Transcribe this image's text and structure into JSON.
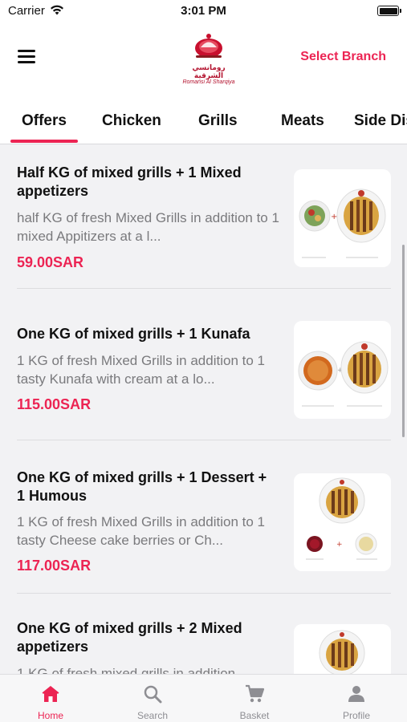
{
  "status_bar": {
    "carrier": "Carrier",
    "time": "3:01 PM"
  },
  "header": {
    "logo_text_ar": "رومانسي الشرقية",
    "logo_text_en": "Romansi Al Sharqiya",
    "select_branch": "Select Branch",
    "accent_color": "#ec2453"
  },
  "tabs": [
    {
      "label": "Offers"
    },
    {
      "label": "Chicken"
    },
    {
      "label": "Grills"
    },
    {
      "label": "Meats"
    },
    {
      "label": "Side Dis"
    }
  ],
  "offers": [
    {
      "title": "Half KG of mixed grills + 1 Mixed appetizers",
      "description": "half KG of fresh Mixed Grills in addition to 1 mixed Appitizers at a l...",
      "price": "59.00SAR"
    },
    {
      "title": "One KG of mixed grills + 1 Kunafa",
      "description": "1 KG of fresh Mixed Grills in addition to 1 tasty Kunafa with cream at a lo...",
      "price": "115.00SAR"
    },
    {
      "title": "One KG of mixed grills + 1 Dessert + 1 Humous",
      "description": "1 KG of fresh Mixed Grills in addition to 1 tasty Cheese cake berries or Ch...",
      "price": "117.00SAR"
    },
    {
      "title": "One KG of mixed grills + 2 Mixed appetizers",
      "description": "1 KG of fresh mixed grills in addition",
      "price": ""
    }
  ],
  "tab_bar": [
    {
      "label": "Home",
      "icon": "home-icon"
    },
    {
      "label": "Search",
      "icon": "search-icon"
    },
    {
      "label": "Basket",
      "icon": "cart-icon"
    },
    {
      "label": "Profile",
      "icon": "person-icon"
    }
  ]
}
